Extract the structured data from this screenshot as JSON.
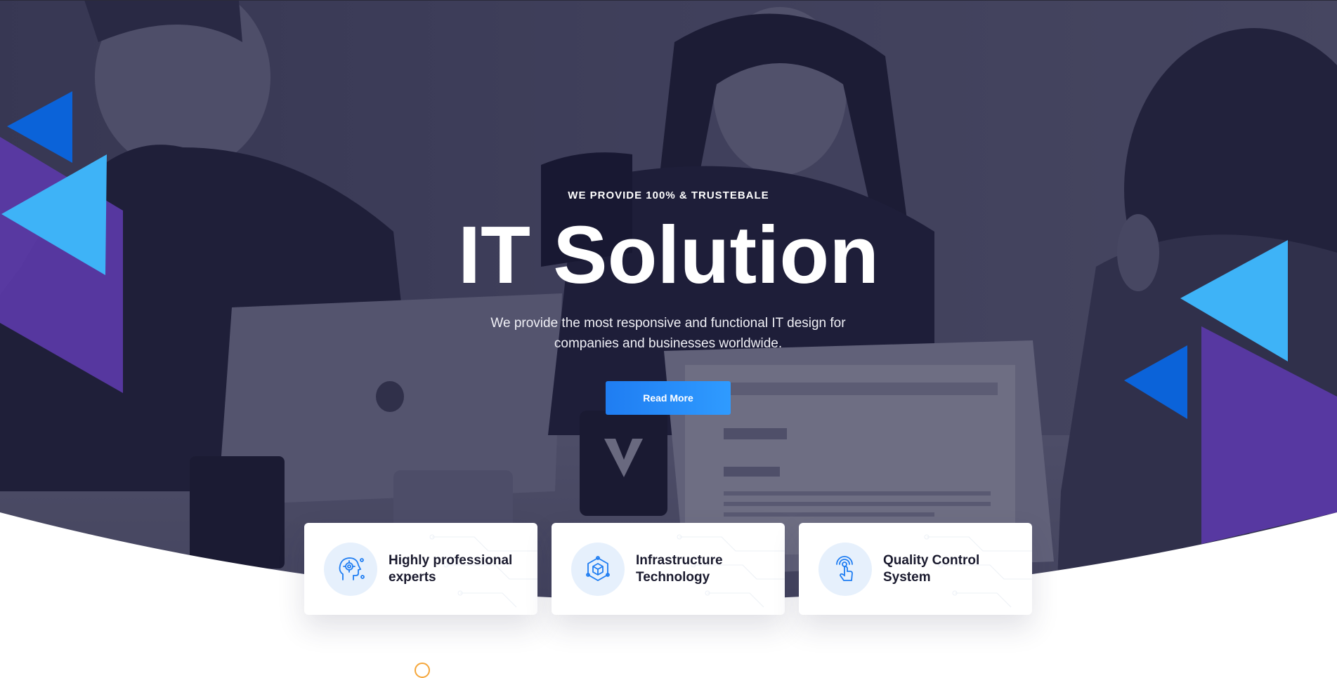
{
  "hero": {
    "eyebrow": "WE PROVIDE 100% & TRUSTEBALE",
    "headline": "IT Solution",
    "subtitle": "We provide the most responsive and functional IT design for companies and businesses worldwide.",
    "cta_label": "Read More",
    "background": "photo of three men working at laptops in an office",
    "overlay_color": "#1c1c38"
  },
  "features": [
    {
      "title": "Highly professional experts",
      "icon": "head-gear-icon"
    },
    {
      "title": "Infrastructure Technology",
      "icon": "cube-network-icon"
    },
    {
      "title": "Quality Control System",
      "icon": "touch-signal-icon"
    }
  ],
  "colors": {
    "accent_blue": "#2f9bff",
    "deep_blue": "#0b63d9",
    "light_blue": "#3eb3f7",
    "purple": "#5b3aa8",
    "icon_bg": "#e6f0fc",
    "card_text": "#1a1a2e"
  }
}
